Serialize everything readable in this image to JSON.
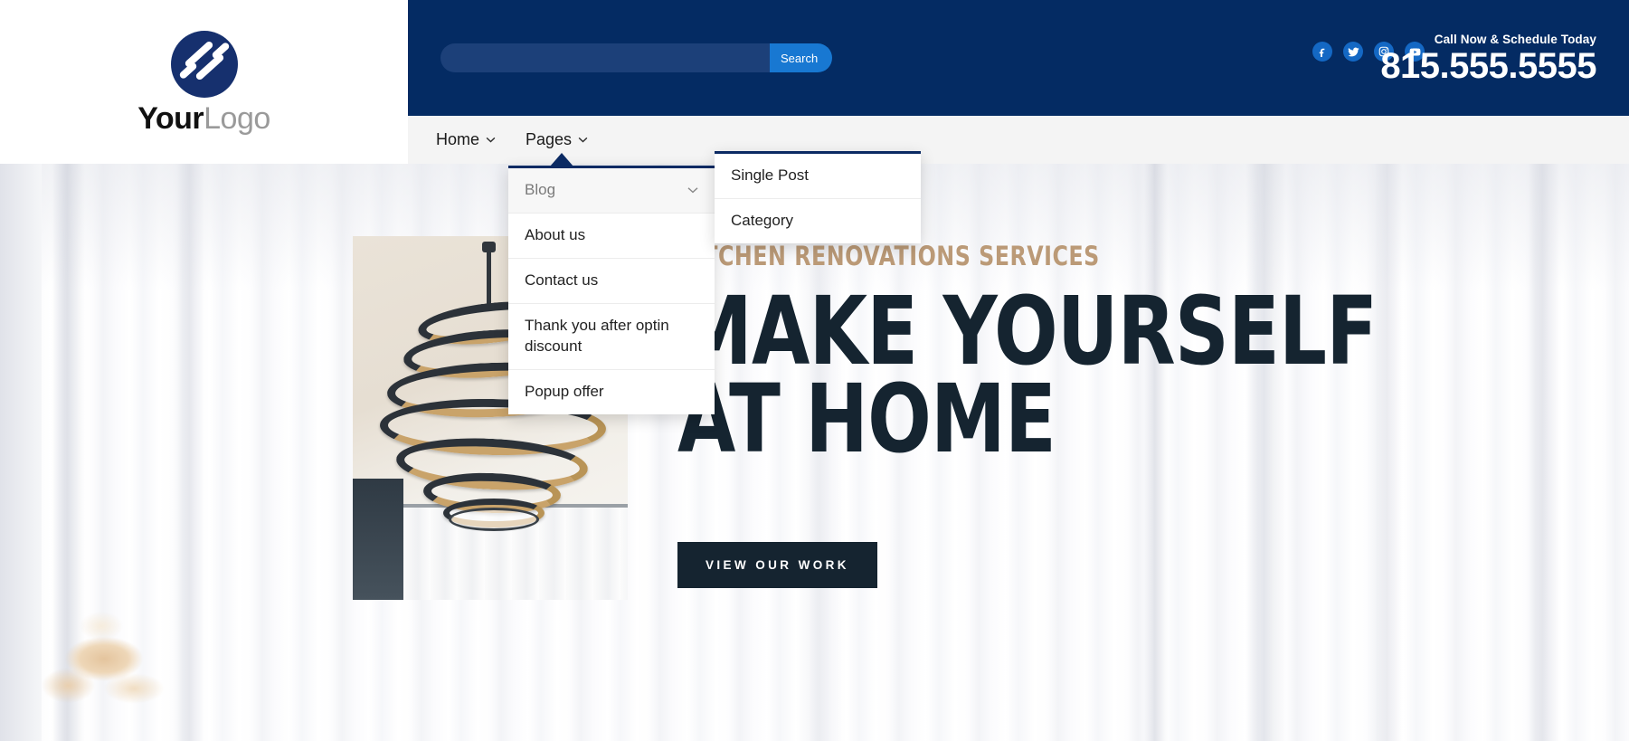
{
  "brand": {
    "logo_text_primary": "Your",
    "logo_text_secondary": "Logo",
    "logo_icon": "circle-s-logo-icon",
    "navy": "#042b63",
    "accent_blue": "#1878d2",
    "headline_navy": "#152430",
    "eyebrow_tan": "#bb9a77"
  },
  "header": {
    "search": {
      "value": "",
      "placeholder": "",
      "button_label": "Search"
    },
    "socials": [
      {
        "name": "facebook-icon",
        "label": "Facebook"
      },
      {
        "name": "twitter-icon",
        "label": "Twitter"
      },
      {
        "name": "instagram-icon",
        "label": "Instagram"
      },
      {
        "name": "youtube-icon",
        "label": "YouTube"
      }
    ],
    "call_label": "Call Now & Schedule Today",
    "phone": "815.555.5555"
  },
  "nav": {
    "items": [
      {
        "label": "Home",
        "has_caret": true,
        "active": false
      },
      {
        "label": "Pages",
        "has_caret": true,
        "active": true
      }
    ]
  },
  "dropdown_level1": {
    "items": [
      {
        "label": "Blog",
        "has_submenu": true,
        "hovered": true
      },
      {
        "label": "About us",
        "has_submenu": false,
        "hovered": false
      },
      {
        "label": "Contact us",
        "has_submenu": false,
        "hovered": false
      },
      {
        "label": "Thank you after optin discount",
        "has_submenu": false,
        "hovered": false
      },
      {
        "label": "Popup offer",
        "has_submenu": false,
        "hovered": false
      }
    ]
  },
  "dropdown_level2": {
    "items": [
      {
        "label": "Single Post"
      },
      {
        "label": "Category"
      }
    ]
  },
  "hero": {
    "eyebrow": "KITCHEN RENOVATIONS SERVICES",
    "headline": "MAKE YOURSELF\nAT HOME",
    "cta_label": "VIEW OUR WORK",
    "photo_alt": "spiral-chandelier-photo"
  }
}
